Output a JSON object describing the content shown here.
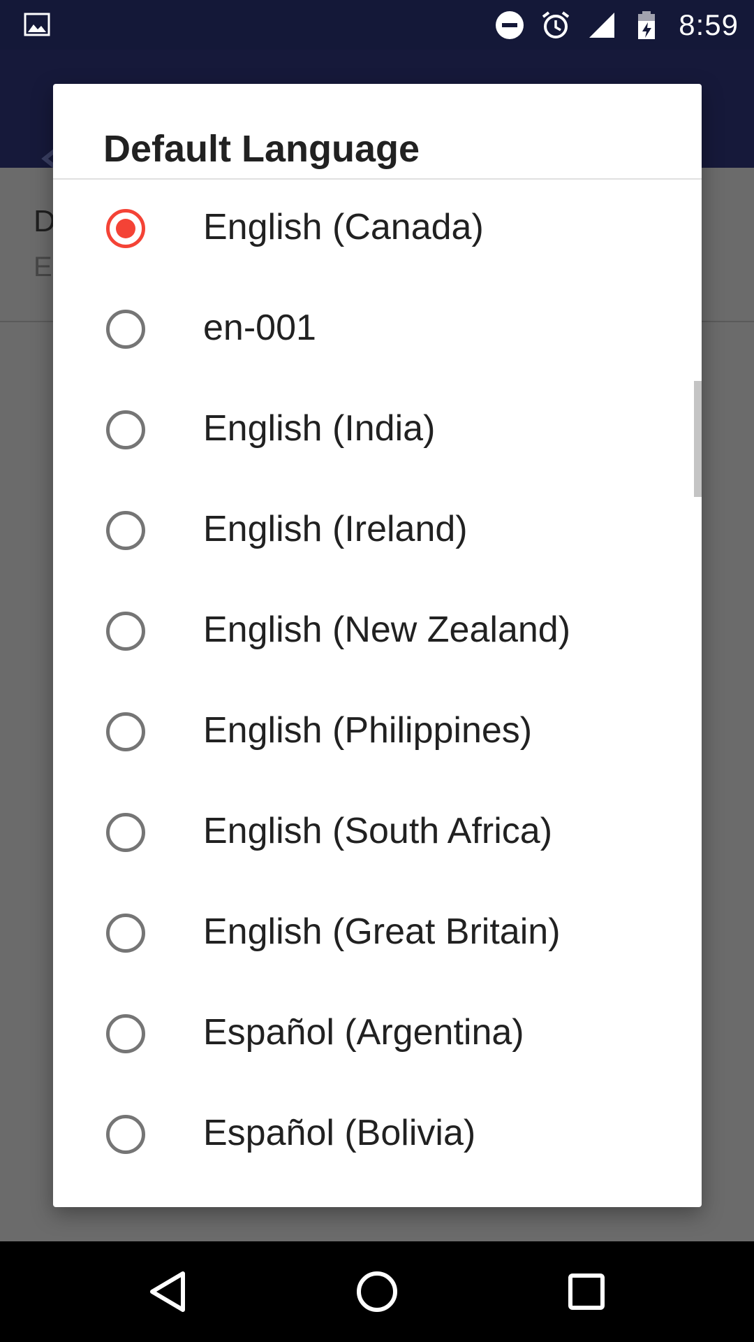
{
  "status_bar": {
    "time": "8:59",
    "left_icon": "image-icon",
    "icons": [
      "do-not-disturb-icon",
      "alarm-icon",
      "signal-icon",
      "battery-charging-icon"
    ]
  },
  "background_pref": {
    "title_initial": "D",
    "summary_initial": "E"
  },
  "dialog": {
    "title": "Default Language",
    "accent_color": "#f44336",
    "selected_index": 0,
    "options": [
      {
        "label": "English (Canada)",
        "checked": true
      },
      {
        "label": "en-001",
        "checked": false
      },
      {
        "label": "English (India)",
        "checked": false
      },
      {
        "label": "English (Ireland)",
        "checked": false
      },
      {
        "label": "English (New Zealand)",
        "checked": false
      },
      {
        "label": "English (Philippines)",
        "checked": false
      },
      {
        "label": "English (South Africa)",
        "checked": false
      },
      {
        "label": "English (Great Britain)",
        "checked": false
      },
      {
        "label": "Español (Argentina)",
        "checked": false
      },
      {
        "label": "Español (Bolivia)",
        "checked": false
      }
    ]
  },
  "nav_bar": {
    "buttons": [
      "back-icon",
      "home-icon",
      "recents-icon"
    ]
  }
}
